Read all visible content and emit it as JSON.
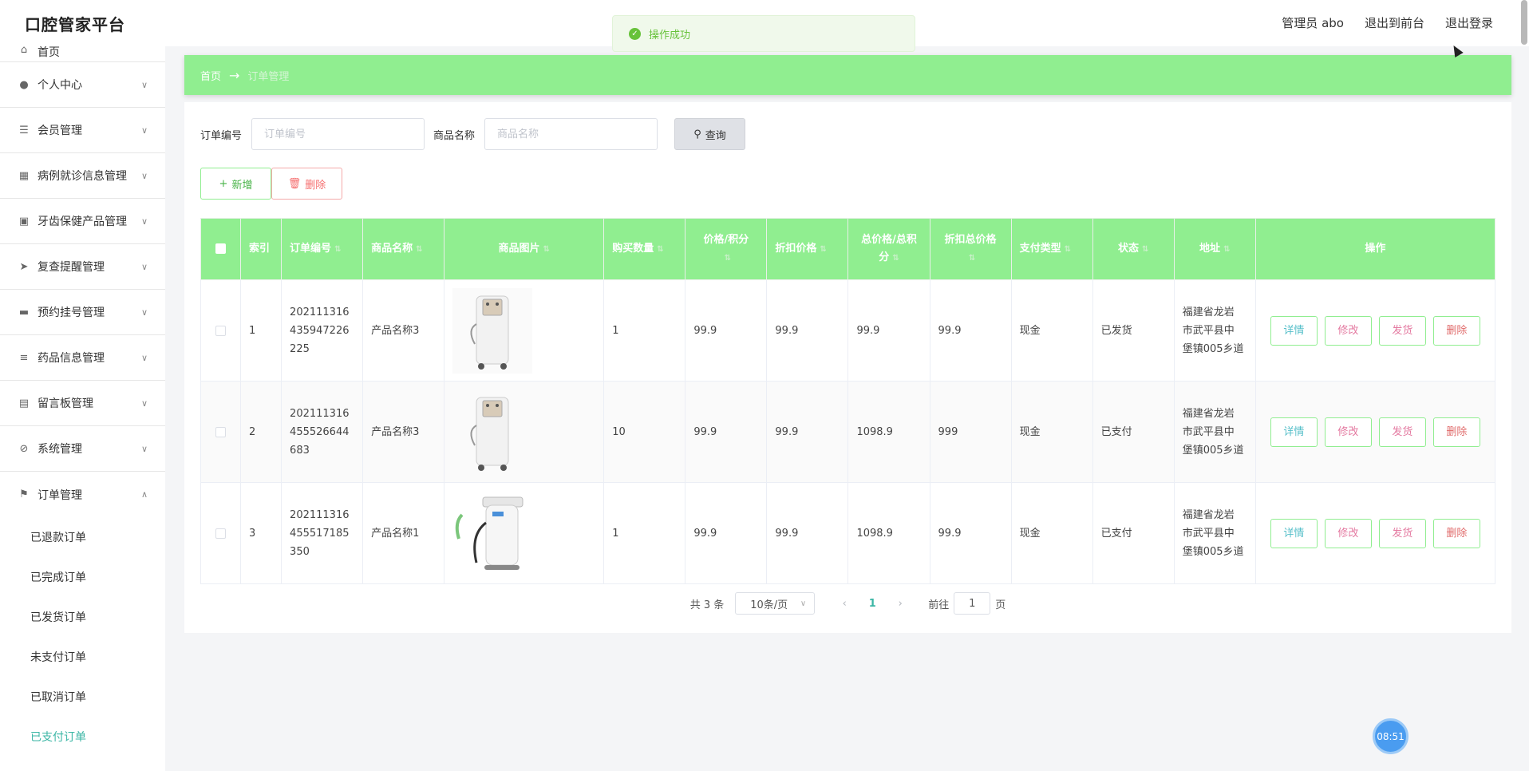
{
  "header": {
    "title": "口腔管家平台",
    "admin_label": "管理员 abo",
    "to_front_label": "退出到前台",
    "logout_label": "退出登录"
  },
  "toast": {
    "message": "操作成功",
    "icon": "success-check-icon",
    "color": "#67c23a"
  },
  "sidebar": {
    "items": [
      {
        "label": "首页",
        "icon": "home-icon"
      },
      {
        "label": "个人中心",
        "icon": "user-icon"
      },
      {
        "label": "会员管理",
        "icon": "sliders-icon"
      },
      {
        "label": "病例就诊信息管理",
        "icon": "grid-icon"
      },
      {
        "label": "牙齿保健产品管理",
        "icon": "tiles-icon"
      },
      {
        "label": "复查提醒管理",
        "icon": "send-icon"
      },
      {
        "label": "预约挂号管理",
        "icon": "briefcase-icon"
      },
      {
        "label": "药品信息管理",
        "icon": "list-icon"
      },
      {
        "label": "留言板管理",
        "icon": "clipboard-icon"
      },
      {
        "label": "系统管理",
        "icon": "bell-off-icon"
      },
      {
        "label": "订单管理",
        "icon": "flag-icon"
      }
    ],
    "sub_items": [
      "已退款订单",
      "已完成订单",
      "已发货订单",
      "未支付订单",
      "已取消订单",
      "已支付订单"
    ],
    "active_sub": "已支付订单"
  },
  "breadcrumb": {
    "home": "首页",
    "current": "订单管理"
  },
  "search": {
    "order_no_label": "订单编号",
    "order_no_placeholder": "订单编号",
    "product_label": "商品名称",
    "product_placeholder": "商品名称",
    "query_label": "查询"
  },
  "actions": {
    "add_label": "新增",
    "delete_label": "删除"
  },
  "table": {
    "columns": [
      "索引",
      "订单编号",
      "商品名称",
      "商品图片",
      "购买数量",
      "价格/积分",
      "折扣价格",
      "总价格/总积分",
      "折扣总价格",
      "支付类型",
      "状态",
      "地址",
      "操作"
    ],
    "op_labels": {
      "detail": "详情",
      "edit": "修改",
      "ship": "发货",
      "delete": "删除"
    },
    "rows": [
      {
        "index": "1",
        "order_no": [
          "202111316",
          "435947226",
          "225"
        ],
        "product": "产品名称3",
        "image": "oxygen-concentrator",
        "qty": "1",
        "price": "99.9",
        "discount_price": "99.9",
        "total": "99.9",
        "discount_total": "99.9",
        "pay_type": "现金",
        "status": "已发货",
        "address": [
          "福建省龙岩",
          "市武平县中",
          "堡镇005乡道"
        ]
      },
      {
        "index": "2",
        "order_no": [
          "202111316",
          "455526644",
          "683"
        ],
        "product": "产品名称3",
        "image": "oxygen-concentrator",
        "qty": "10",
        "price": "99.9",
        "discount_price": "99.9",
        "total": "1098.9",
        "discount_total": "999",
        "pay_type": "现金",
        "status": "已支付",
        "address": [
          "福建省龙岩",
          "市武平县中",
          "堡镇005乡道"
        ]
      },
      {
        "index": "3",
        "order_no": [
          "202111316",
          "455517185",
          "350"
        ],
        "product": "产品名称1",
        "image": "dental-device",
        "qty": "1",
        "price": "99.9",
        "discount_price": "99.9",
        "total": "1098.9",
        "discount_total": "99.9",
        "pay_type": "现金",
        "status": "已支付",
        "address": [
          "福建省龙岩",
          "市武平县中",
          "堡镇005乡道"
        ]
      }
    ]
  },
  "pagination": {
    "total_label": "共 3 条",
    "page_size": "10条/页",
    "current_page": "1",
    "goto_prefix": "前往",
    "goto_value": "1",
    "goto_suffix": "页"
  },
  "clock": "08:51",
  "colors": {
    "accent": "#90ee90",
    "active": "#3bb6a5"
  }
}
